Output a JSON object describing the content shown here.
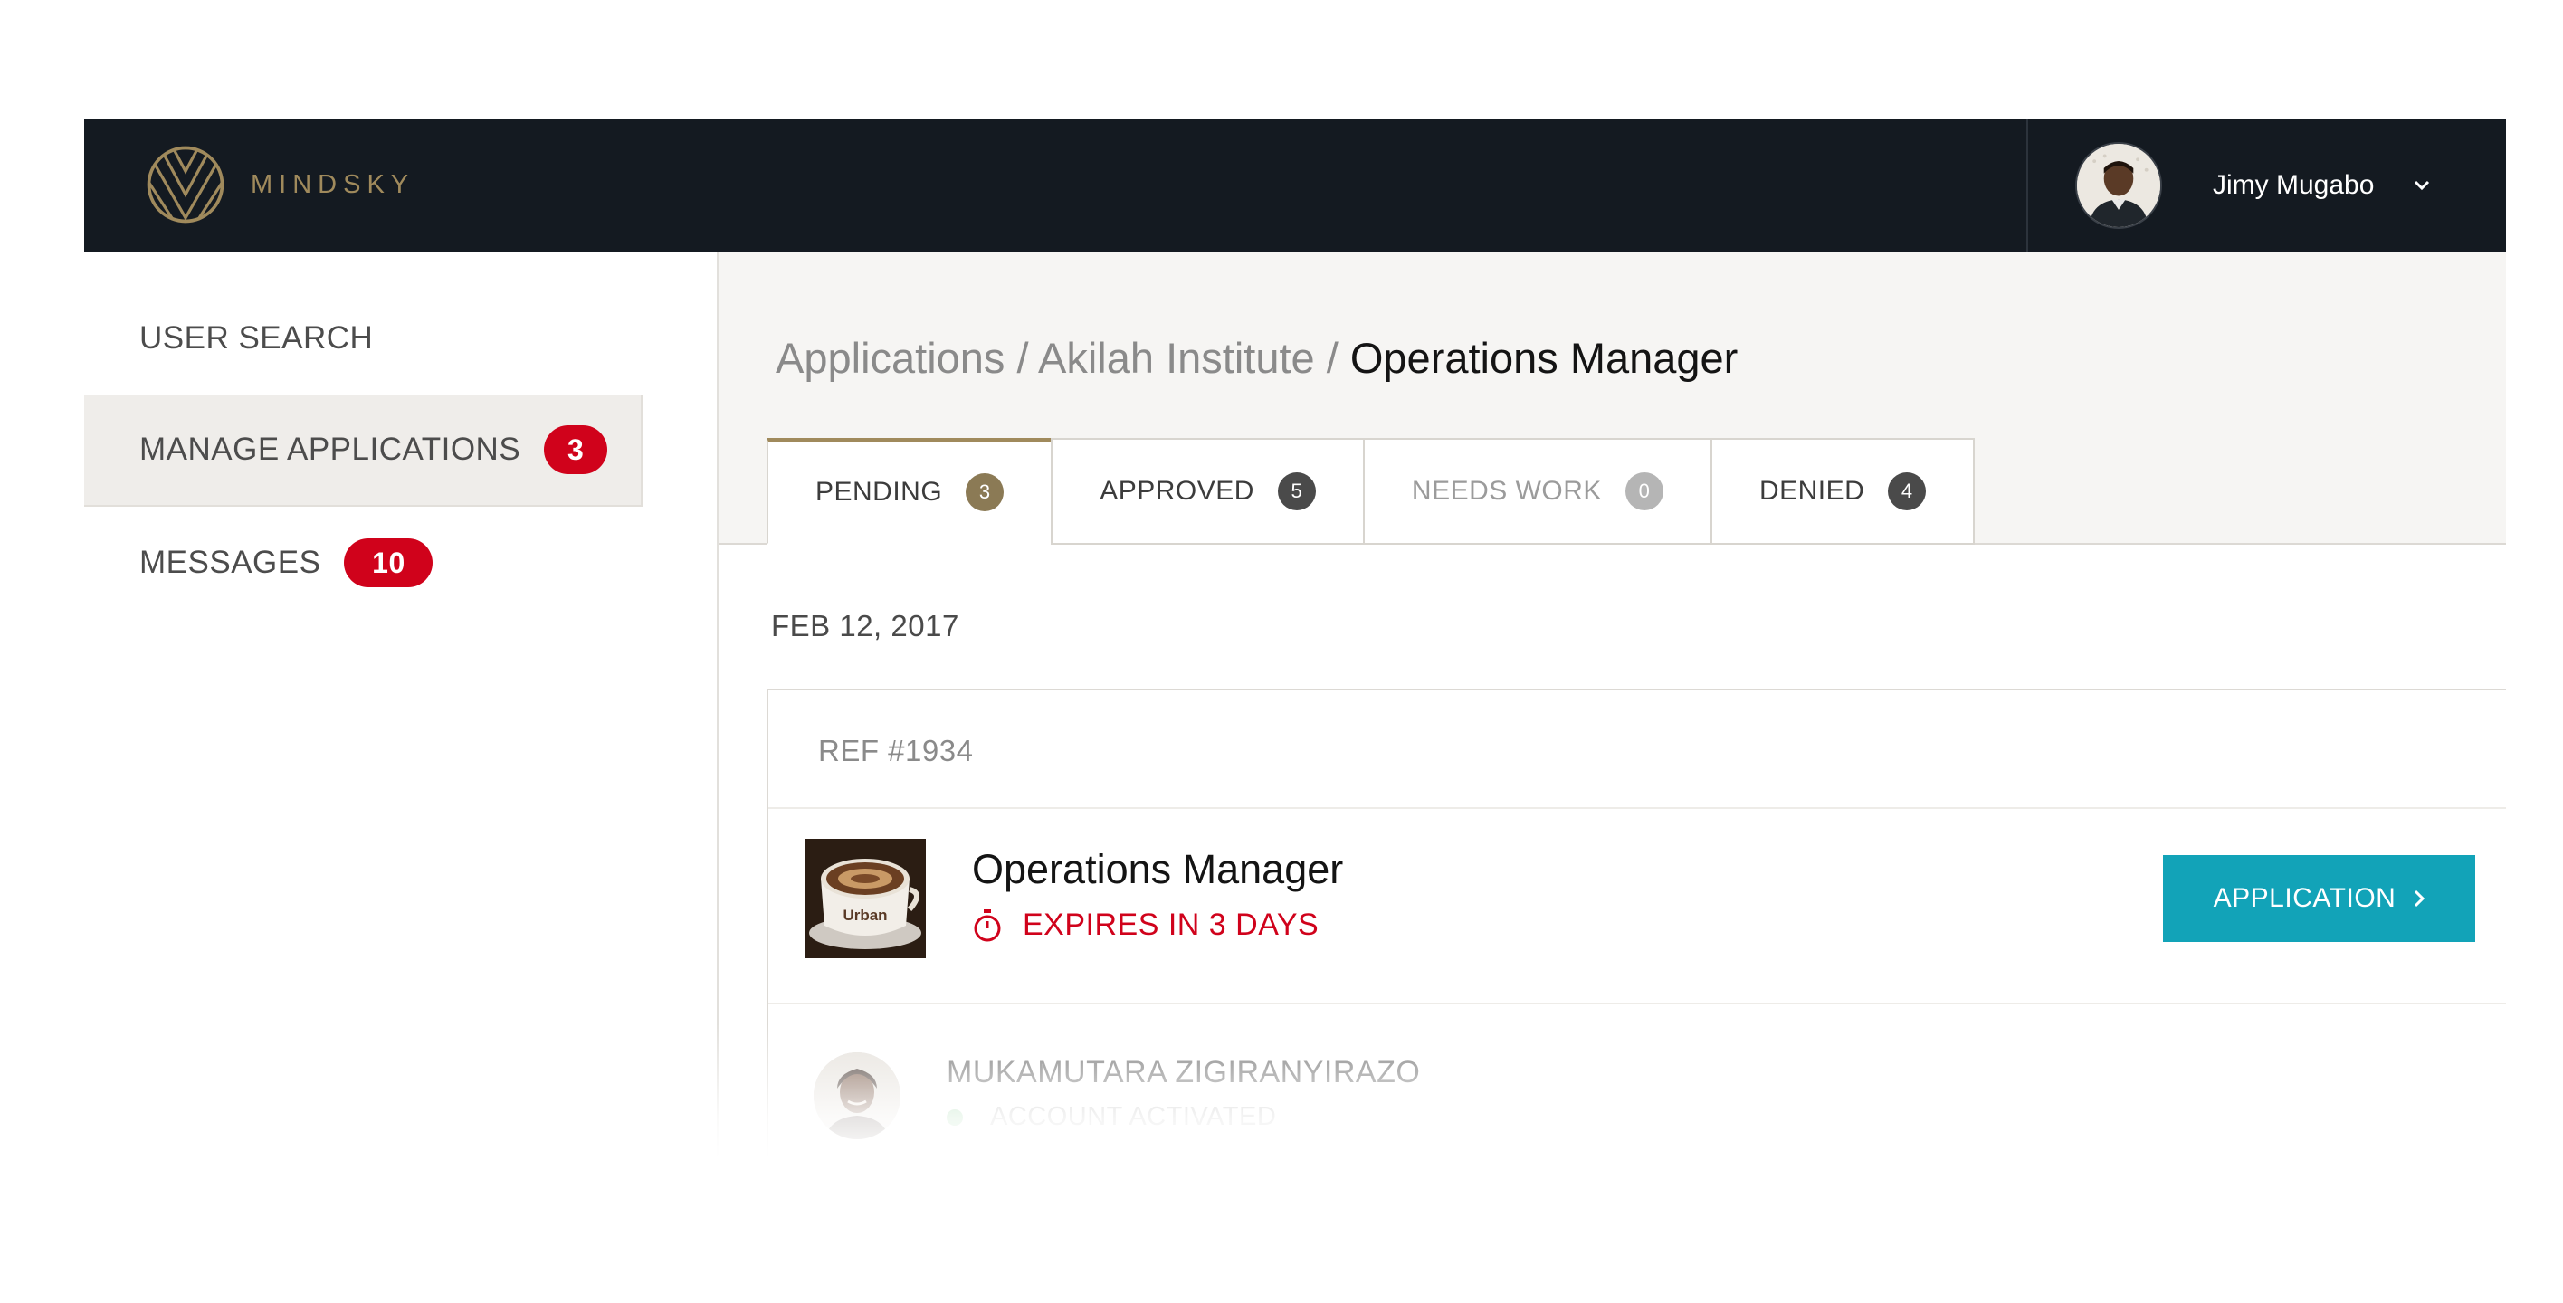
{
  "brand": {
    "name": "MINDSKY",
    "color": "#a08a5c"
  },
  "user": {
    "name": "Jimy Mugabo"
  },
  "sidebar": {
    "items": [
      {
        "label": "USER SEARCH"
      },
      {
        "label": "MANAGE APPLICATIONS",
        "badge": "3",
        "active": true
      },
      {
        "label": "MESSAGES",
        "badge": "10"
      }
    ]
  },
  "breadcrumb": {
    "path": "Applications / Akilah Institute /",
    "current": "Operations Manager"
  },
  "tabs": [
    {
      "label": "PENDING",
      "count": "3",
      "active": true,
      "color": "#8b7a55"
    },
    {
      "label": "APPROVED",
      "count": "5",
      "color": "#4a4a4a"
    },
    {
      "label": "NEEDS WORK",
      "count": "0",
      "color": "#b5b5b5"
    },
    {
      "label": "DENIED",
      "count": "4",
      "color": "#4a4a4a"
    }
  ],
  "group": {
    "date": "FEB 12, 2017",
    "card": {
      "ref": "REF #1934",
      "job_title": "Operations Manager",
      "expires": "EXPIRES IN 3 DAYS",
      "thumb_text": "Urban",
      "button_label": "APPLICATION",
      "applicant": {
        "name": "MUKAMUTARA ZIGIRANYIRAZO",
        "status": "ACCOUNT ACTIVATED"
      }
    }
  },
  "colors": {
    "accent": "#12a3b8",
    "alert": "#d0021b",
    "topbar": "#141a21"
  }
}
